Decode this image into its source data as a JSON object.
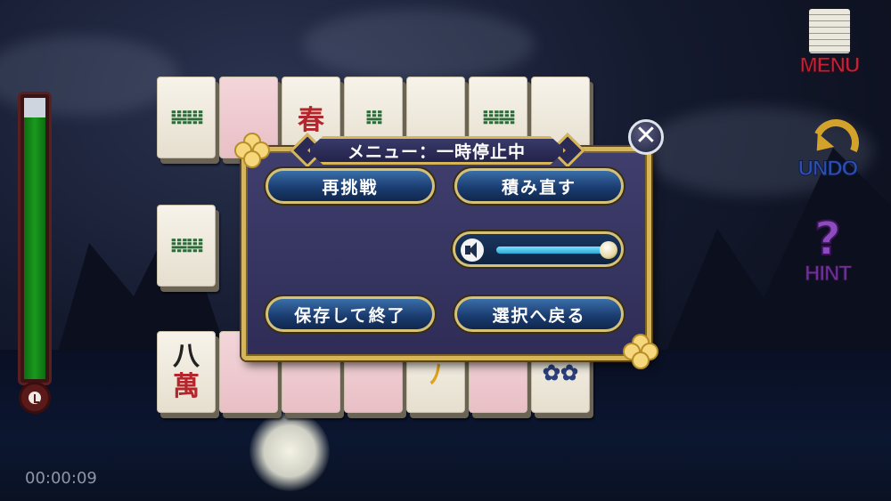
{
  "timer": {
    "elapsed": "00:00:09",
    "gauge_fill_fraction": 0.93
  },
  "sidebar": {
    "menu_label": "MENU",
    "undo_label": "UNDO",
    "hint_label": "HINT"
  },
  "tiles": {
    "spring": "春",
    "eight": "八",
    "wan": "萬"
  },
  "dialog": {
    "title": "メニュー：一時停止中",
    "close_glyph": "✕",
    "retry_label": "再挑戦",
    "reshuffle_label": "積み直す",
    "save_quit_label": "保存して終了",
    "back_to_select_label": "選択へ戻る",
    "volume_level": 1.0
  },
  "colors": {
    "gold_border": "#d7b65a",
    "panel": "#3f3e6d",
    "button_blue": "#1b3d71",
    "gauge_green": "#1a9a1f"
  }
}
